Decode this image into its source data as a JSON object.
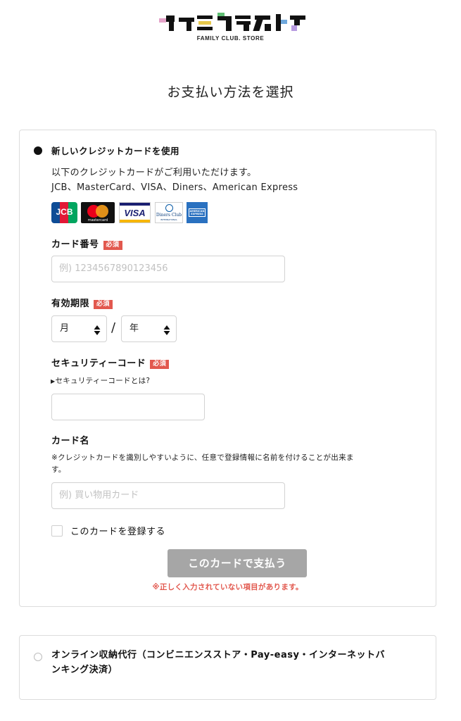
{
  "logo": {
    "subtitle": "FAMILY CLUB. STORE"
  },
  "page_title": "お支払い方法を選択",
  "card_option": {
    "title": "新しいクレジットカードを使用",
    "description_line1": "以下のクレジットカードがご利用いただけます。",
    "description_line2": "JCB、MasterCard、VISA、Diners、American Express",
    "brands": {
      "jcb": "JCB",
      "mastercard": "mastercard",
      "visa": "VISA",
      "diners_line1": "Diners Club",
      "diners_line2": "INTERNATIONAL",
      "amex": "AMERICAN EXPRESS"
    },
    "required_badge": "必須",
    "card_number": {
      "label": "カード番号",
      "placeholder": "例) 1234567890123456"
    },
    "expiry": {
      "label": "有効期限",
      "month": "月",
      "separator": "/",
      "year": "年"
    },
    "security_code": {
      "label": "セキュリティーコード",
      "help_link": "セキュリティーコードとは?"
    },
    "card_name": {
      "label": "カード名",
      "note_line1": "※クレジットカードを識別しやすいように、任意で登録情報に名前を付けることが出来ま",
      "note_line2": "す。",
      "placeholder": "例) 買い物用カード"
    },
    "register_checkbox": "このカードを登録する",
    "pay_button": "このカードで支払う",
    "error_message": "※正しく入力されていない項目があります。"
  },
  "online_option": {
    "title_line1": "オンライン収納代行（コンビニエンスストア・Pay-easy・インターネットバ",
    "title_line2": "ンキング決済）"
  },
  "colors": {
    "required_badge": "#e2584e",
    "button_disabled": "#a6a6a6",
    "error_text": "#e2584e"
  }
}
